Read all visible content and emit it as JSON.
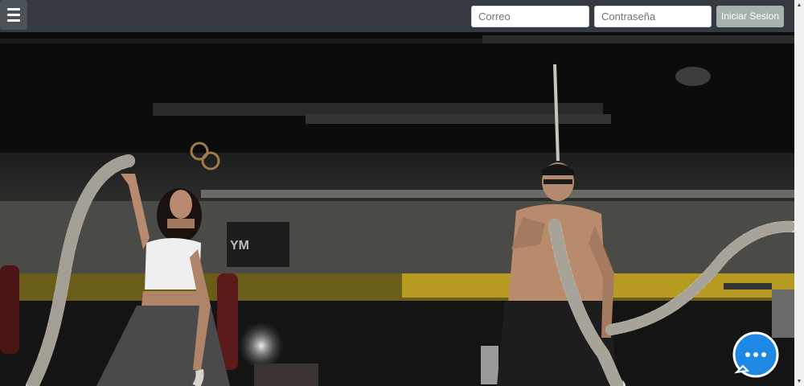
{
  "navbar": {
    "menu_icon": "hamburger-menu-icon",
    "email_placeholder": "Correo",
    "password_placeholder": "Contraseña",
    "login_label": "Iniciar Sesion"
  },
  "hero": {
    "image": "gym-battle-ropes-photo"
  },
  "chat": {
    "icon": "chat-bubble-icon",
    "color": "#1e88e5"
  },
  "colors": {
    "navbar": "#343a40",
    "login_button": "#a6b3ac"
  }
}
